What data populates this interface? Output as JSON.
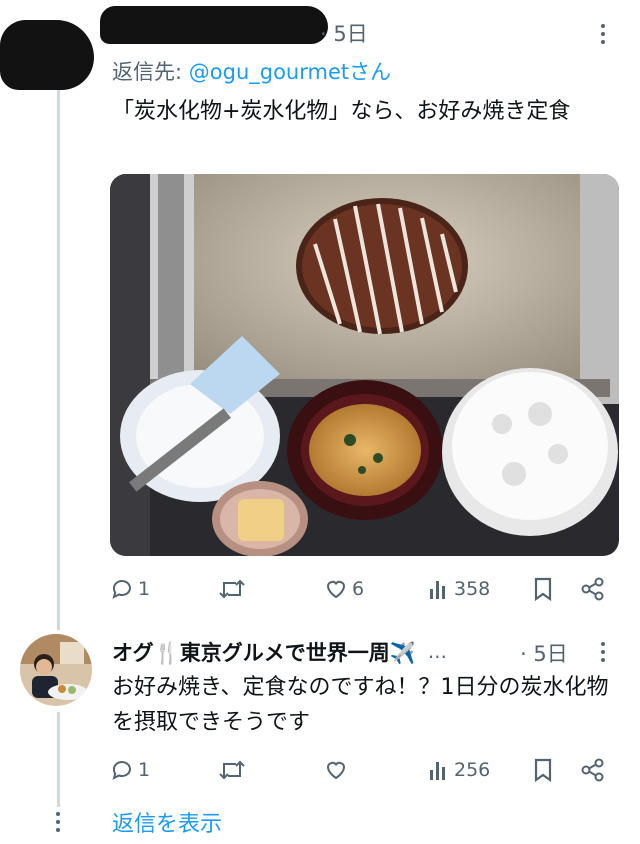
{
  "colors": {
    "accent": "#1d9bf0",
    "muted": "#536471",
    "text": "#0f1419",
    "line": "#cfd9de"
  },
  "tweet1": {
    "time": "· 5日",
    "reply_prefix": "返信先: ",
    "reply_handle": "@ogu_gourmetさん",
    "text": "「炭水化物+炭水化物」なら、お好み焼き定食",
    "image_alt_icon": "photo-of-okonomiyaki-set-meal",
    "actions": {
      "replies": "1",
      "views": "358"
    }
  },
  "tweet2": {
    "author": "オグ🍴東京グルメで世界一周✈️",
    "ellipsis": "…",
    "time": "· 5日",
    "text": "お好み焼き、定食なのですね！？1日分の炭水化物を摂取できそうです",
    "actions": {
      "replies": "1",
      "views": "256"
    }
  },
  "show_replies": "返信を表示",
  "icons": [
    "reply-icon",
    "retweet-icon",
    "like-icon",
    "views-icon",
    "bookmark-icon",
    "share-icon",
    "more-icon"
  ]
}
